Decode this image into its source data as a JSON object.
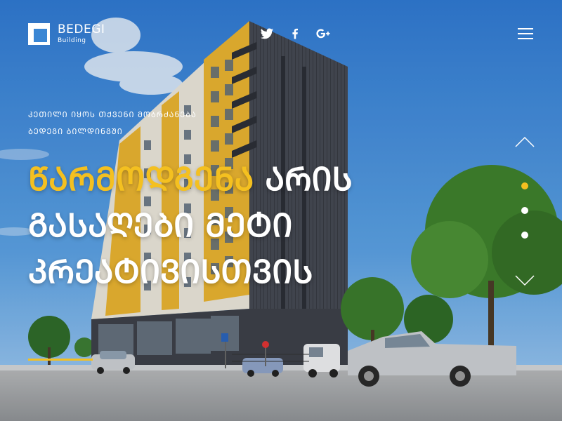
{
  "brand": {
    "name": "BEDEGI",
    "subtitle": "Building"
  },
  "social": [
    {
      "icon": "twitter-icon"
    },
    {
      "icon": "facebook-icon"
    },
    {
      "icon": "google-plus-icon"
    }
  ],
  "hero": {
    "tagline_line1": "ᲙᲔᲗᲘᲚᲘ ᲘᲧᲝᲡ ᲗᲥᲕᲔᲜᲘ ᲛᲝᲑᲠᲫᲐᲜᲔᲑᲐ",
    "tagline_line2": "ᲑᲔᲓᲔᲒᲘ ᲑᲘᲚᲓᲘᲜᲒᲨᲘ",
    "headline_accent": "ᲬᲐᲠᲛᲝᲓᲒᲔᲜᲐ",
    "headline_rest1": " ᲐᲠᲘᲡ",
    "headline_line2": "ᲒᲐᲡᲐᲦᲔᲑᲘ ᲛᲔᲢᲘ",
    "headline_line3": "ᲙᲠᲔᲐᲢᲘᲕᲘᲡᲗᲕᲘᲡ"
  },
  "slider": {
    "active_index": 0,
    "count": 3
  },
  "colors": {
    "accent": "#f4c020",
    "sky": "#3a86d4",
    "text": "#ffffff"
  }
}
